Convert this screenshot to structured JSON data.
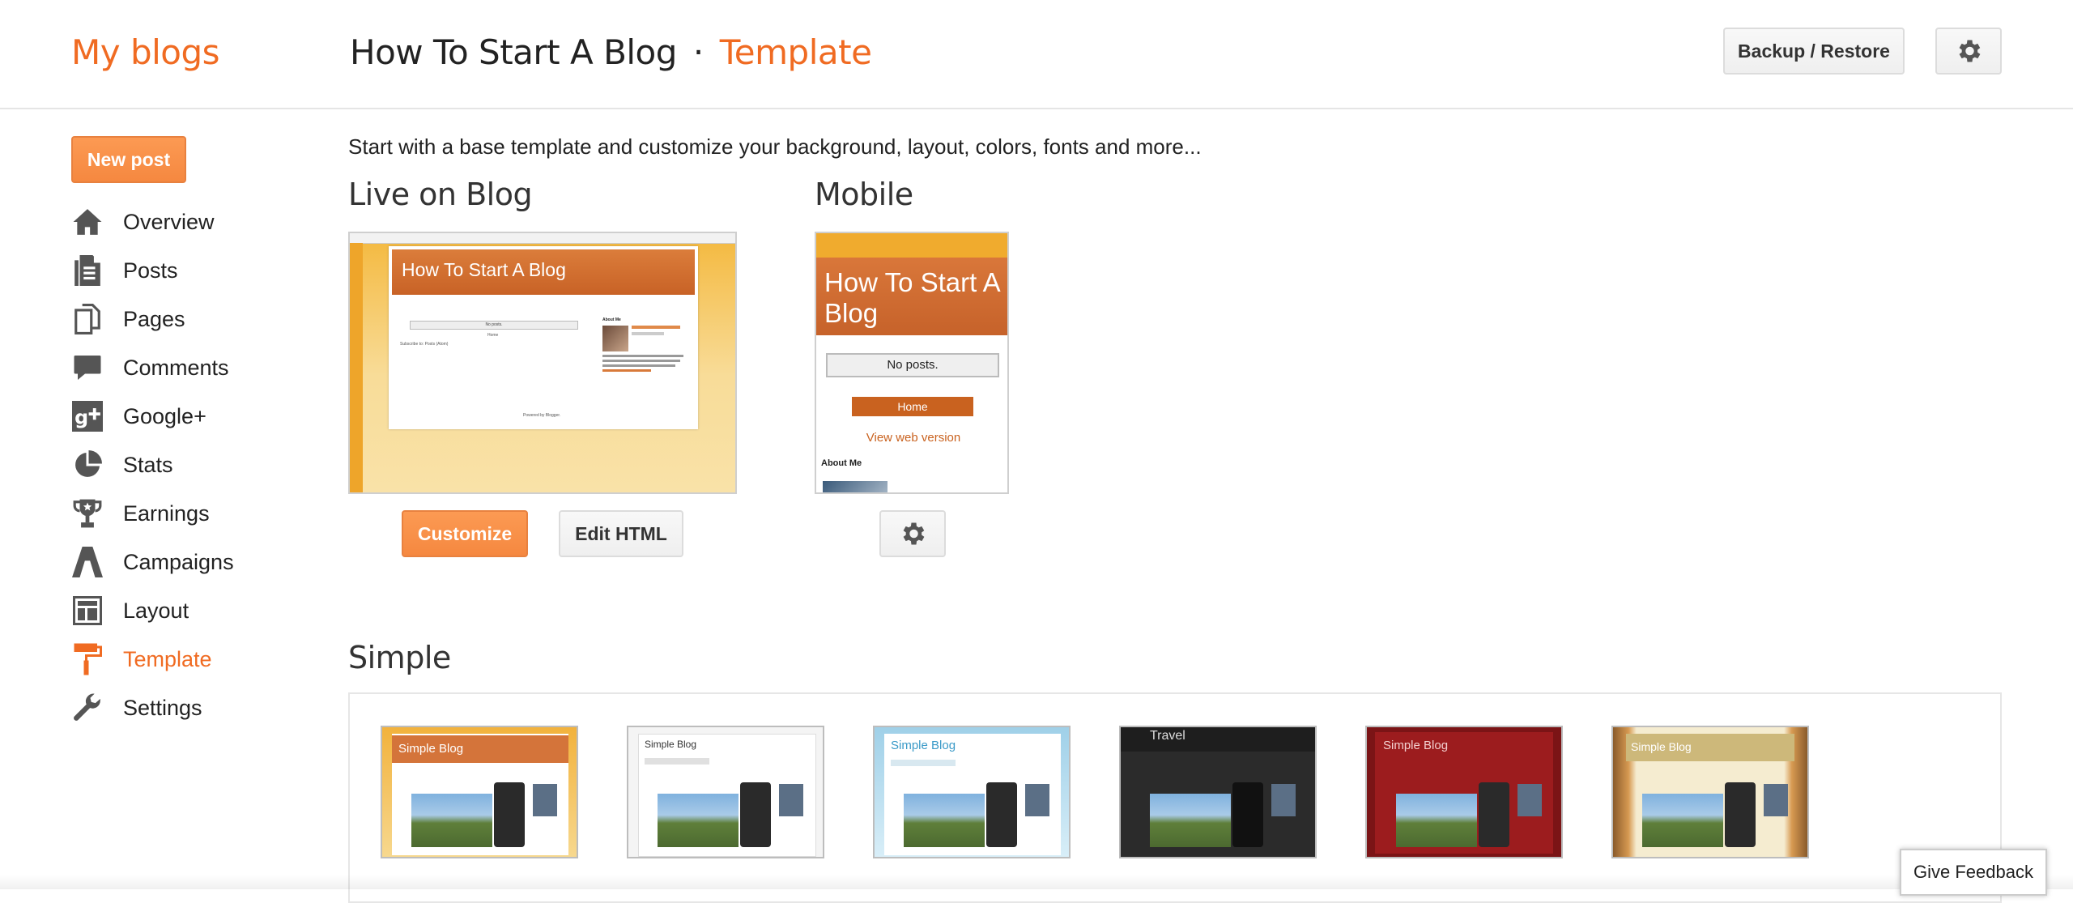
{
  "header": {
    "my_blogs": "My blogs",
    "blog_name": "How To Start A Blog",
    "separator": "·",
    "section": "Template",
    "backup_label": "Backup / Restore",
    "settings_icon": "gear-icon"
  },
  "sidebar": {
    "new_post": "New post",
    "items": [
      {
        "label": "Overview",
        "icon": "home-icon"
      },
      {
        "label": "Posts",
        "icon": "posts-icon"
      },
      {
        "label": "Pages",
        "icon": "pages-icon"
      },
      {
        "label": "Comments",
        "icon": "comment-icon"
      },
      {
        "label": "Google+",
        "icon": "google-plus-icon"
      },
      {
        "label": "Stats",
        "icon": "pie-chart-icon"
      },
      {
        "label": "Earnings",
        "icon": "trophy-icon"
      },
      {
        "label": "Campaigns",
        "icon": "campaigns-icon"
      },
      {
        "label": "Layout",
        "icon": "layout-icon"
      },
      {
        "label": "Template",
        "icon": "paint-roller-icon",
        "active": true
      },
      {
        "label": "Settings",
        "icon": "wrench-icon"
      }
    ]
  },
  "main": {
    "intro": "Start with a base template and customize your background, layout, colors, fonts and more...",
    "live_heading": "Live on Blog",
    "mobile_heading": "Mobile",
    "live_preview": {
      "blog_title": "How To Start A Blog",
      "no_posts": "No posts.",
      "home": "Home",
      "subscribe": "Subscribe to: Posts (Atom)",
      "about_me": "About Me",
      "powered_by": "Powered by Blogger."
    },
    "mobile_preview": {
      "blog_title": "How To Start A Blog",
      "no_posts": "No posts.",
      "home": "Home",
      "view_web": "View web version",
      "about_me": "About Me"
    },
    "customize_label": "Customize",
    "edit_html_label": "Edit HTML",
    "simple_heading": "Simple",
    "thumbnails": [
      {
        "title": "Simple Blog",
        "variant": "orange"
      },
      {
        "title": "Simple Blog",
        "variant": "white"
      },
      {
        "title": "Simple Blog",
        "variant": "blue"
      },
      {
        "title": "Travel",
        "variant": "dark"
      },
      {
        "title": "Simple Blog",
        "variant": "red"
      },
      {
        "title": "Simple Blog",
        "variant": "tan"
      }
    ]
  },
  "feedback": "Give Feedback",
  "colors": {
    "accent": "#f06b22",
    "button_orange": "#f78d45",
    "template_orange": "#cf6a29",
    "template_bg": "#f2b43b"
  }
}
